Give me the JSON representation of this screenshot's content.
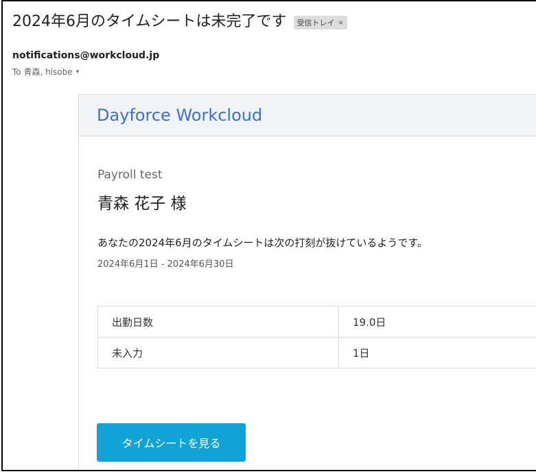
{
  "email": {
    "subject": "2024年6月のタイムシートは未完了です",
    "label_chip": "受信トレイ",
    "label_close": "×",
    "sender": "notifications@workcloud.jp",
    "recipients": "To 青森, hisobe",
    "recipients_caret": "▾"
  },
  "card": {
    "brand": "Dayforce Workcloud",
    "company": "Payroll test",
    "recipient_name": "青森 花子 様",
    "message": "あなたの2024年6月のタイムシートは次の打刻が抜けているようです。",
    "period": "2024年6月1日 - 2024年6月30日",
    "table": [
      {
        "label": "出勤日数",
        "value": "19.0日"
      },
      {
        "label": "未入力",
        "value": "1日"
      }
    ],
    "cta_label": "タイムシートを見る",
    "cta_color": "#12a3d6",
    "brand_color": "#3b6fd8"
  }
}
